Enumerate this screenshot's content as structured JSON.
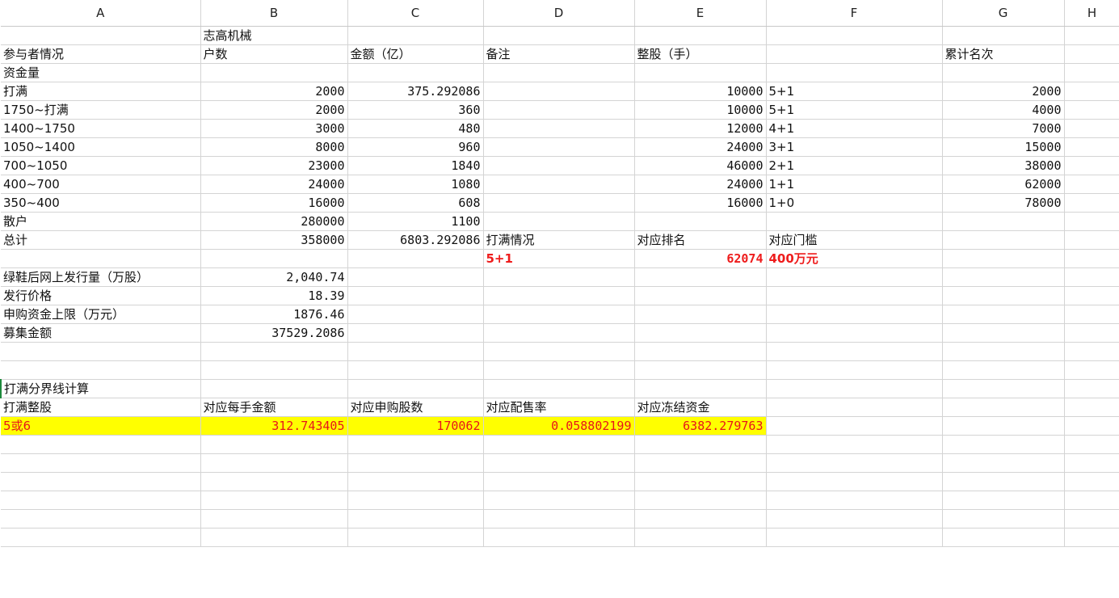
{
  "columns": [
    "A",
    "B",
    "C",
    "D",
    "E",
    "F",
    "G",
    "H"
  ],
  "rows": [
    [
      "",
      "志高机械",
      "",
      "",
      "",
      "",
      "",
      ""
    ],
    [
      "参与者情况",
      "户数",
      "金额（亿）",
      "备注",
      "整股（手）",
      "",
      "累计名次",
      ""
    ],
    [
      "资金量",
      "",
      "",
      "",
      "",
      "",
      "",
      ""
    ],
    [
      "打满",
      "2000",
      "375.292086",
      "",
      "10000",
      "5+1",
      "2000",
      ""
    ],
    [
      "1750~打满",
      "2000",
      "360",
      "",
      "10000",
      "5+1",
      "4000",
      ""
    ],
    [
      "1400~1750",
      "3000",
      "480",
      "",
      "12000",
      "4+1",
      "7000",
      ""
    ],
    [
      "1050~1400",
      "8000",
      "960",
      "",
      "24000",
      "3+1",
      "15000",
      ""
    ],
    [
      "700~1050",
      "23000",
      "1840",
      "",
      "46000",
      "2+1",
      "38000",
      ""
    ],
    [
      "400~700",
      "24000",
      "1080",
      "",
      "24000",
      "1+1",
      "62000",
      ""
    ],
    [
      "350~400",
      "16000",
      "608",
      "",
      "16000",
      "1+0",
      "78000",
      ""
    ],
    [
      "散户",
      "280000",
      "1100",
      "",
      "",
      "",
      "",
      ""
    ],
    [
      "总计",
      "358000",
      "6803.292086",
      "打满情况",
      "对应排名",
      "对应门槛",
      "",
      ""
    ],
    [
      "",
      "",
      "",
      "5+1",
      "62074",
      "400万元",
      "",
      ""
    ],
    [
      "绿鞋后网上发行量（万股）",
      "2,040.74",
      "",
      "",
      "",
      "",
      "",
      ""
    ],
    [
      "发行价格",
      "18.39",
      "",
      "",
      "",
      "",
      "",
      ""
    ],
    [
      "申购资金上限（万元）",
      "1876.46",
      "",
      "",
      "",
      "",
      "",
      ""
    ],
    [
      "募集金额",
      "37529.2086",
      "",
      "",
      "",
      "",
      "",
      ""
    ],
    [
      "",
      "",
      "",
      "",
      "",
      "",
      "",
      ""
    ],
    [
      "",
      "",
      "",
      "",
      "",
      "",
      "",
      ""
    ],
    [
      "打满分界线计算",
      "",
      "",
      "",
      "",
      "",
      "",
      ""
    ],
    [
      "打满整股",
      "对应每手金额",
      "对应申购股数",
      "对应配售率",
      "对应冻结资金",
      "",
      "",
      ""
    ],
    [
      "5或6",
      "312.743405",
      "170062",
      "0.058802199",
      "6382.279763",
      "",
      "",
      ""
    ],
    [
      "",
      "",
      "",
      "",
      "",
      "",
      "",
      ""
    ],
    [
      "",
      "",
      "",
      "",
      "",
      "",
      "",
      ""
    ],
    [
      "",
      "",
      "",
      "",
      "",
      "",
      "",
      ""
    ],
    [
      "",
      "",
      "",
      "",
      "",
      "",
      "",
      ""
    ],
    [
      "",
      "",
      "",
      "",
      "",
      "",
      "",
      ""
    ],
    [
      "",
      "",
      "",
      "",
      "",
      "",
      "",
      ""
    ]
  ],
  "colors": {
    "highlight_bg": "#ffff00",
    "highlight_text": "#e8141a",
    "red_text": "#ee1c1c",
    "grid": "#d4d4d4"
  }
}
